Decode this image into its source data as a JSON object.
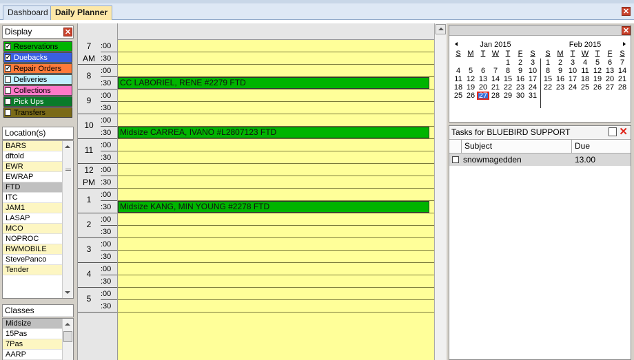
{
  "tabs": [
    {
      "label": "Dashboard",
      "active": false
    },
    {
      "label": "Daily Planner",
      "active": true
    }
  ],
  "close_glyph": "✕",
  "display_panel": {
    "title": "Display",
    "items": [
      {
        "label": "Reservations",
        "checked": true,
        "color": "#00b400"
      },
      {
        "label": "Duebacks",
        "checked": true,
        "color": "#3a5fe0"
      },
      {
        "label": "Repair Orders",
        "checked": true,
        "color": "#ff7a3a"
      },
      {
        "label": "Deliveries",
        "checked": false,
        "color": "#bfefff"
      },
      {
        "label": "Collections",
        "checked": false,
        "color": "#ff78c8"
      },
      {
        "label": "Pick Ups",
        "checked": false,
        "color": "#0a7a2a"
      },
      {
        "label": "Transfers",
        "checked": false,
        "color": "#7a6a18"
      }
    ]
  },
  "locations": {
    "title": "Location(s)",
    "items": [
      {
        "label": "BARS",
        "style": "yl"
      },
      {
        "label": "dftold",
        "style": ""
      },
      {
        "label": "EWR",
        "style": "yl"
      },
      {
        "label": "EWRAP",
        "style": ""
      },
      {
        "label": "FTD",
        "style": "sel"
      },
      {
        "label": "ITC",
        "style": ""
      },
      {
        "label": "JAM1",
        "style": "yl"
      },
      {
        "label": "LASAP",
        "style": ""
      },
      {
        "label": "MCO",
        "style": "yl"
      },
      {
        "label": "NOPROC",
        "style": ""
      },
      {
        "label": "RWMOBILE",
        "style": "yl"
      },
      {
        "label": "StevePanco",
        "style": ""
      },
      {
        "label": "Tender",
        "style": "yl"
      }
    ]
  },
  "classes": {
    "title": "Classes",
    "items": [
      {
        "label": "Midsize",
        "style": "sel"
      },
      {
        "label": "15Pas",
        "style": ""
      },
      {
        "label": "7Pas",
        "style": "yl"
      },
      {
        "label": "AARP",
        "style": ""
      }
    ]
  },
  "times": [
    {
      "hour": "7",
      "suffix": "AM"
    },
    {
      "hour": "8",
      "suffix": ""
    },
    {
      "hour": "9",
      "suffix": ""
    },
    {
      "hour": "10",
      "suffix": ""
    },
    {
      "hour": "11",
      "suffix": ""
    },
    {
      "hour": "12",
      "suffix": "PM"
    },
    {
      "hour": "1",
      "suffix": ""
    },
    {
      "hour": "2",
      "suffix": ""
    },
    {
      "hour": "3",
      "suffix": ""
    },
    {
      "hour": "4",
      "suffix": ""
    },
    {
      "hour": "5",
      "suffix": ""
    }
  ],
  "minute_labels": [
    ":00",
    ":30"
  ],
  "appointments": [
    {
      "slot_index": 3,
      "text": "CC LABORIEL, RENE #2279 FTD"
    },
    {
      "slot_index": 7,
      "text": "Midsize CARREA, IVANO #L2807123 FTD"
    },
    {
      "slot_index": 13,
      "text": "Midsize KANG, MIN YOUNG #2278 FTD"
    }
  ],
  "calendar": {
    "months": [
      {
        "title": "Jan 2015",
        "dows": [
          "S",
          "M",
          "T",
          "W",
          "T",
          "F",
          "S"
        ],
        "weeks": [
          [
            "",
            "",
            "",
            "",
            "1",
            "2",
            "3"
          ],
          [
            "4",
            "5",
            "6",
            "7",
            "8",
            "9",
            "10"
          ],
          [
            "11",
            "12",
            "13",
            "14",
            "15",
            "16",
            "17"
          ],
          [
            "18",
            "19",
            "20",
            "21",
            "22",
            "23",
            "24"
          ],
          [
            "25",
            "26",
            "27",
            "28",
            "29",
            "30",
            "31"
          ]
        ],
        "today": "27"
      },
      {
        "title": "Feb 2015",
        "dows": [
          "S",
          "M",
          "T",
          "W",
          "T",
          "F",
          "S"
        ],
        "weeks": [
          [
            "1",
            "2",
            "3",
            "4",
            "5",
            "6",
            "7"
          ],
          [
            "8",
            "9",
            "10",
            "11",
            "12",
            "13",
            "14"
          ],
          [
            "15",
            "16",
            "17",
            "18",
            "19",
            "20",
            "21"
          ],
          [
            "22",
            "23",
            "24",
            "25",
            "26",
            "27",
            "28"
          ]
        ],
        "today": ""
      }
    ]
  },
  "tasks": {
    "title": "Tasks for BLUEBIRD SUPPORT",
    "col_subject": "Subject",
    "col_due": "Due",
    "rows": [
      {
        "subject": "snowmagedden",
        "due": "13.00"
      }
    ]
  }
}
